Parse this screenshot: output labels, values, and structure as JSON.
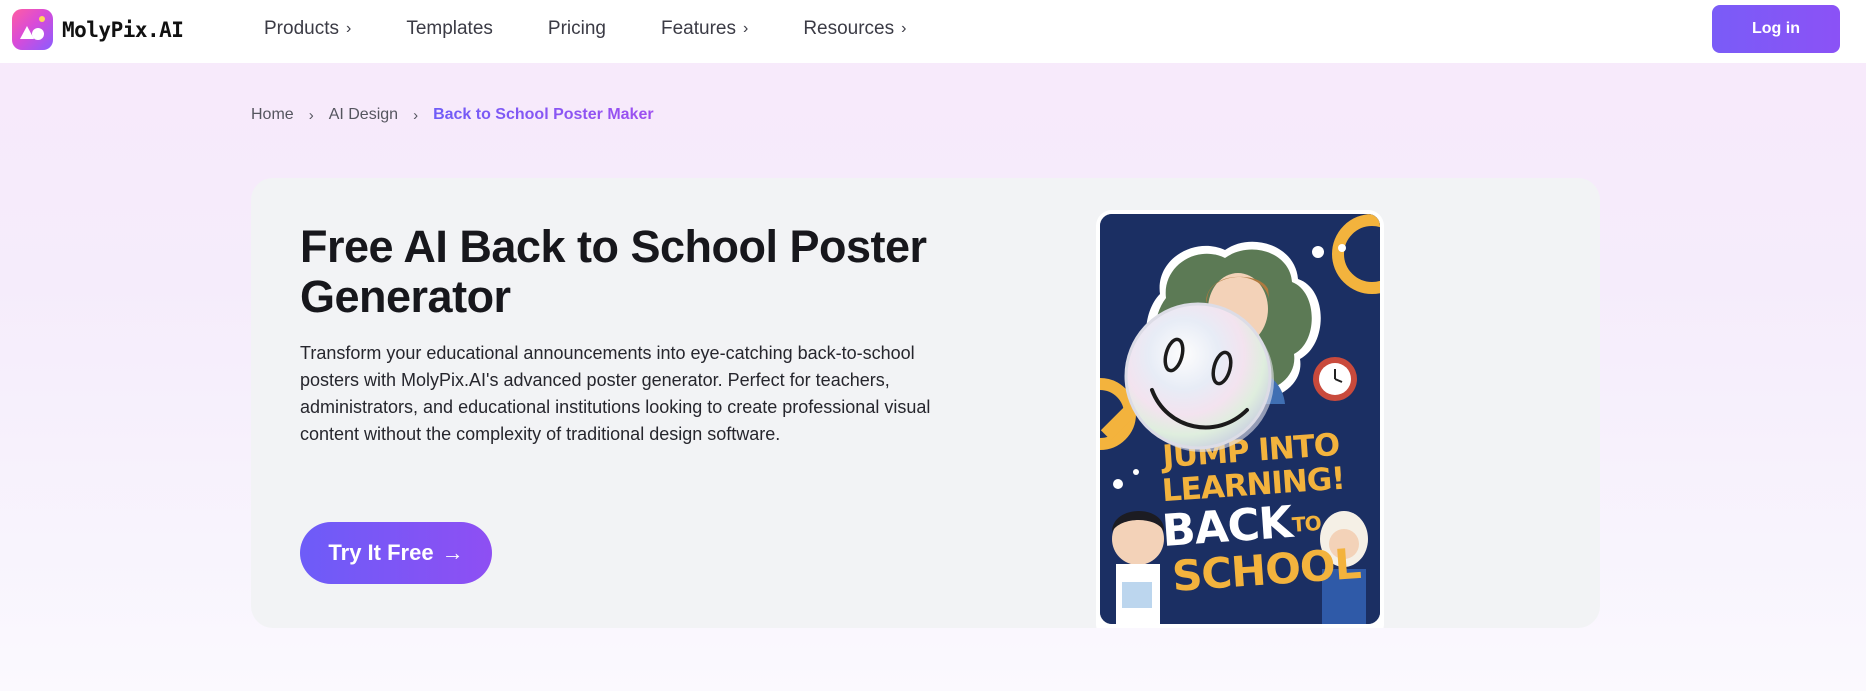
{
  "header": {
    "logo_text": "MolyPix.AI",
    "nav": [
      {
        "label": "Products",
        "has_chevron": true
      },
      {
        "label": "Templates",
        "has_chevron": false
      },
      {
        "label": "Pricing",
        "has_chevron": false
      },
      {
        "label": "Features",
        "has_chevron": true
      },
      {
        "label": "Resources",
        "has_chevron": true
      }
    ],
    "login_label": "Log in"
  },
  "breadcrumb": {
    "items": [
      "Home",
      "AI Design",
      "Back to School Poster Maker"
    ],
    "separator": "›"
  },
  "hero": {
    "title": "Free AI Back to School Poster Generator",
    "description": "Transform your educational announcements into eye-catching back-to-school posters with MolyPix.AI's advanced poster generator. Perfect for teachers, administrators, and educational institutions looking to create professional visual content without the complexity of traditional design software.",
    "cta_label": "Try It Free",
    "cta_icon": "arrow-right-icon"
  },
  "poster": {
    "line1": "JUMP INTO LEARNING!",
    "line2": "BACK",
    "line2_small": "TO",
    "line3": "SCHOOL"
  },
  "colors": {
    "brand_gradient_start": "#6d5cf8",
    "brand_gradient_end": "#8e4ff3",
    "poster_navy": "#1b2f63",
    "poster_yellow": "#f3b33d"
  }
}
